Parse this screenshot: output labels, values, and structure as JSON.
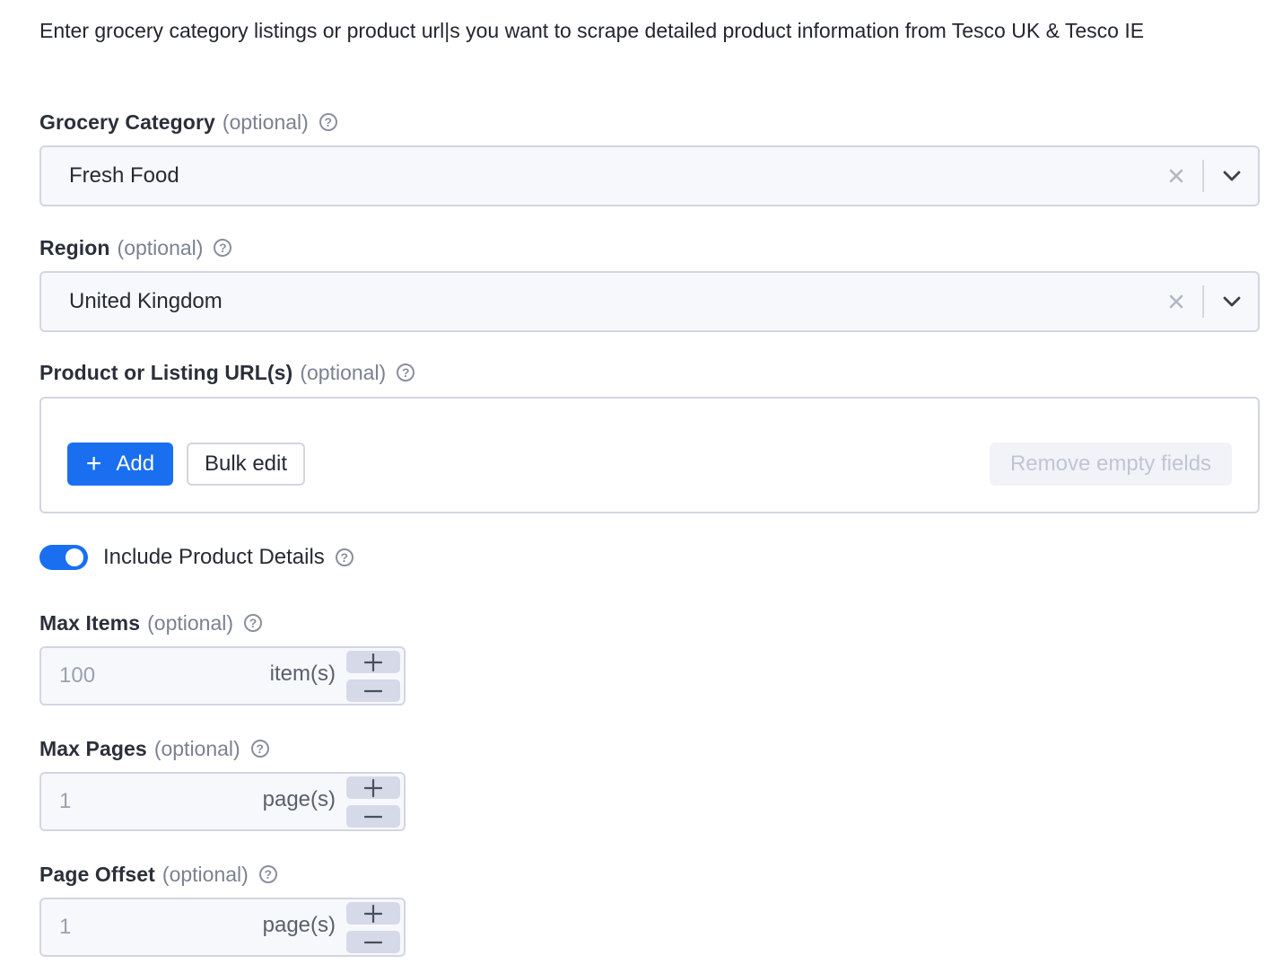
{
  "intro": "Enter grocery category listings or product url|s you want to scrape detailed product information from Tesco UK & Tesco IE",
  "optional_text": "(optional)",
  "grocery_category": {
    "label": "Grocery Category",
    "value": "Fresh Food"
  },
  "region": {
    "label": "Region",
    "value": "United Kingdom"
  },
  "urls": {
    "label": "Product or Listing URL(s)",
    "add_label": "Add",
    "bulk_edit_label": "Bulk edit",
    "remove_empty_label": "Remove empty fields"
  },
  "include_details": {
    "label": "Include Product Details",
    "enabled": true
  },
  "max_items": {
    "label": "Max Items",
    "value": "100",
    "unit": "item(s)"
  },
  "max_pages": {
    "label": "Max Pages",
    "value": "1",
    "unit": "page(s)"
  },
  "page_offset": {
    "label": "Page Offset",
    "value": "1",
    "unit": "page(s)"
  },
  "colors": {
    "accent": "#1a6ff0",
    "border": "#d3d6e1",
    "field_bg": "#f7f8fb"
  },
  "icons": [
    "help-icon",
    "clear-icon",
    "chevron-down-icon",
    "plus-icon",
    "minus-icon"
  ]
}
